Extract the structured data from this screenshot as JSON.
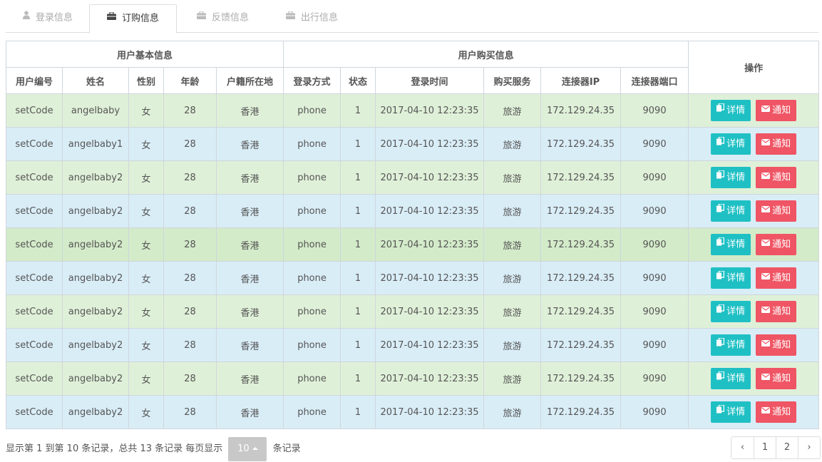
{
  "tabs": [
    {
      "label": "登录信息",
      "icon": "user-icon"
    },
    {
      "label": "订购信息",
      "icon": "briefcase-icon"
    },
    {
      "label": "反馈信息",
      "icon": "briefcase-icon"
    },
    {
      "label": "出行信息",
      "icon": "briefcase-icon"
    }
  ],
  "active_tab": 1,
  "table": {
    "group_headers": {
      "basic": "用户基本信息",
      "purchase": "用户购买信息",
      "actions": "操作"
    },
    "columns": [
      "用户编号",
      "姓名",
      "性别",
      "年龄",
      "户籍所在地",
      "登录方式",
      "状态",
      "登录时间",
      "购买服务",
      "连接器IP",
      "连接器端口"
    ],
    "detail_label": "详情",
    "notice_label": "通知",
    "rows": [
      [
        "setCode",
        "angelbaby",
        "女",
        "28",
        "香港",
        "phone",
        "1",
        "2017-04-10 12:23:35",
        "旅游",
        "172.129.24.35",
        "9090"
      ],
      [
        "setCode",
        "angelbaby1",
        "女",
        "28",
        "香港",
        "phone",
        "1",
        "2017-04-10 12:23:35",
        "旅游",
        "172.129.24.35",
        "9090"
      ],
      [
        "setCode",
        "angelbaby2",
        "女",
        "28",
        "香港",
        "phone",
        "1",
        "2017-04-10 12:23:35",
        "旅游",
        "172.129.24.35",
        "9090"
      ],
      [
        "setCode",
        "angelbaby2",
        "女",
        "28",
        "香港",
        "phone",
        "1",
        "2017-04-10 12:23:35",
        "旅游",
        "172.129.24.35",
        "9090"
      ],
      [
        "setCode",
        "angelbaby2",
        "女",
        "28",
        "香港",
        "phone",
        "1",
        "2017-04-10 12:23:35",
        "旅游",
        "172.129.24.35",
        "9090"
      ],
      [
        "setCode",
        "angelbaby2",
        "女",
        "28",
        "香港",
        "phone",
        "1",
        "2017-04-10 12:23:35",
        "旅游",
        "172.129.24.35",
        "9090"
      ],
      [
        "setCode",
        "angelbaby2",
        "女",
        "28",
        "香港",
        "phone",
        "1",
        "2017-04-10 12:23:35",
        "旅游",
        "172.129.24.35",
        "9090"
      ],
      [
        "setCode",
        "angelbaby2",
        "女",
        "28",
        "香港",
        "phone",
        "1",
        "2017-04-10 12:23:35",
        "旅游",
        "172.129.24.35",
        "9090"
      ],
      [
        "setCode",
        "angelbaby2",
        "女",
        "28",
        "香港",
        "phone",
        "1",
        "2017-04-10 12:23:35",
        "旅游",
        "172.129.24.35",
        "9090"
      ],
      [
        "setCode",
        "angelbaby2",
        "女",
        "28",
        "香港",
        "phone",
        "1",
        "2017-04-10 12:23:35",
        "旅游",
        "172.129.24.35",
        "9090"
      ]
    ]
  },
  "footer": {
    "summary_prefix": "显示第 1 到第 10 条记录，总共 13 条记录 每页显示",
    "page_size": "10",
    "summary_suffix": "条记录"
  },
  "pagination": {
    "prev": "‹",
    "pages": [
      "1",
      "2"
    ],
    "next": "›"
  },
  "colors": {
    "detail_button": "#1fc0c4",
    "notice_button": "#ef5564",
    "row_green": "#dff0d8",
    "row_blue": "#d9edf7",
    "page_size_bg": "#c8c8c8"
  }
}
